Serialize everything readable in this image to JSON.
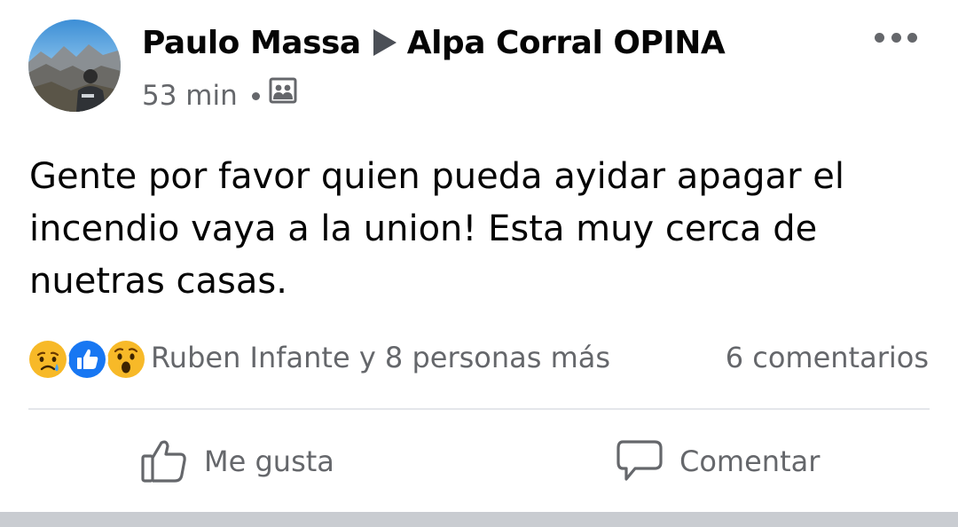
{
  "post": {
    "author": "Paulo Massa",
    "group": "Alpa Corral OPINA",
    "time": "53 min",
    "privacy_icon": "group-audience-icon",
    "text": "Gente por favor quien pueda ayidar apagar el\nincendio vaya a la union! Esta muy cerca de\nnuetras casas."
  },
  "reactions": {
    "icons": [
      "sad-reaction-icon",
      "like-reaction-icon",
      "wow-reaction-icon"
    ],
    "summary": "Ruben Infante y 8 personas más",
    "comments": "6 comentarios"
  },
  "actions": {
    "like_label": "Me gusta",
    "comment_label": "Comentar"
  },
  "colors": {
    "secondary_text": "#65676b",
    "like_blue": "#1877f2",
    "reaction_yellow": "#f7b928",
    "divider": "#e4e6eb"
  }
}
